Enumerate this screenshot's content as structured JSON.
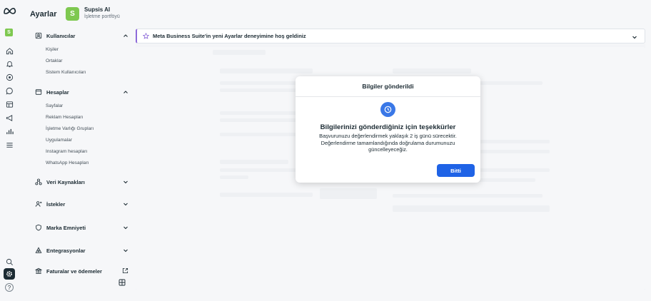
{
  "app": {
    "title": "Ayarlar"
  },
  "business": {
    "avatar_letter": "S",
    "name": "Supsis AI",
    "portfolio_label": "İşletme portföyü"
  },
  "rail": {
    "avatar_letter": "S",
    "icons": [
      "meta-logo",
      "home-icon",
      "bell-icon",
      "target-icon",
      "chat-icon",
      "content-icon",
      "megaphone-icon",
      "insights-icon",
      "menu-icon",
      "search-icon",
      "gear-icon",
      "help-icon"
    ]
  },
  "menu": {
    "users": {
      "label": "Kullanıcılar",
      "items": [
        "Kişiler",
        "Ortaklar",
        "Sistem Kullanıcıları"
      ]
    },
    "accounts": {
      "label": "Hesaplar",
      "items": [
        "Sayfalar",
        "Reklam Hesapları",
        "İşletme Varlığı Grupları",
        "Uygulamalar",
        "Instagram hesapları",
        "WhatsApp Hesapları"
      ]
    },
    "data_sources": {
      "label": "Veri Kaynakları"
    },
    "requests": {
      "label": "İstekler"
    },
    "brand_safety": {
      "label": "Marka Emniyeti"
    },
    "integrations": {
      "label": "Entegrasyonlar"
    },
    "billing": {
      "label": "Faturalar ve ödemeler"
    }
  },
  "banner": {
    "text": "Meta Business Suite'in yeni Ayarlar deneyimine hoş geldiniz"
  },
  "modal": {
    "header": "Bilgiler gönderildi",
    "title": "Bilgilerinizi gönderdiğiniz için teşekkürler",
    "body": "Başvurunuzu değerlendirmek yaklaşık 2 iş günü sürecektir. Değerlendirme tamamlandığında doğrulama durumunuzu güncelleyeceğiz.",
    "done_button": "Bitti"
  },
  "colors": {
    "accent": "#1f63e6",
    "brand_green": "#7ec850",
    "banner_accent": "#8d6ad9"
  }
}
